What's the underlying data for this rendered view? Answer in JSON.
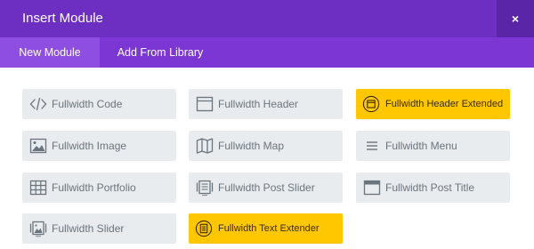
{
  "dialog": {
    "title": "Insert Module",
    "close_glyph": "×"
  },
  "tabs": [
    {
      "label": "New Module",
      "active": true
    },
    {
      "label": "Add From Library",
      "active": false
    }
  ],
  "modules": [
    {
      "label": "Fullwidth Code",
      "icon": "code-icon",
      "highlighted": false
    },
    {
      "label": "Fullwidth Header",
      "icon": "header-window-icon",
      "highlighted": false
    },
    {
      "label": "Fullwidth Header Extended",
      "icon": "header-extended-icon",
      "highlighted": true
    },
    {
      "label": "Fullwidth Image",
      "icon": "image-icon",
      "highlighted": false
    },
    {
      "label": "Fullwidth Map",
      "icon": "map-icon",
      "highlighted": false
    },
    {
      "label": "Fullwidth Menu",
      "icon": "menu-icon",
      "highlighted": false
    },
    {
      "label": "Fullwidth Portfolio",
      "icon": "grid-icon",
      "highlighted": false
    },
    {
      "label": "Fullwidth Post Slider",
      "icon": "post-slider-icon",
      "highlighted": false
    },
    {
      "label": "Fullwidth Post Title",
      "icon": "post-title-icon",
      "highlighted": false
    },
    {
      "label": "Fullwidth Slider",
      "icon": "slider-icon",
      "highlighted": false
    },
    {
      "label": "Fullwidth Text Extender",
      "icon": "text-extender-icon",
      "highlighted": true
    }
  ],
  "colors": {
    "titlebar": "#6d2fc1",
    "tabbar": "#7c36d4",
    "active_tab": "#8f4ee2",
    "module_bg": "#e9ecef",
    "highlight": "#ffc700"
  }
}
